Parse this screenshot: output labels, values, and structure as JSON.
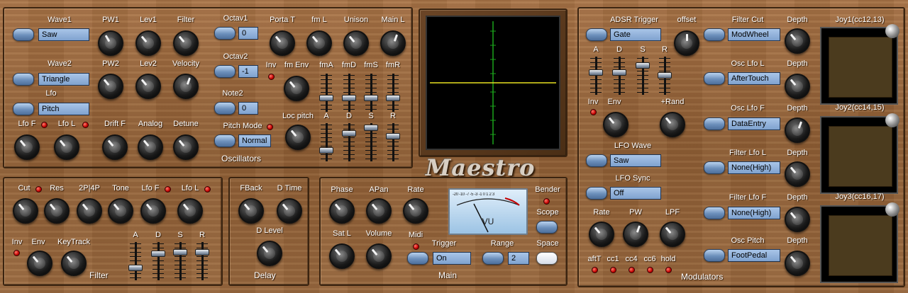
{
  "osc": {
    "wave1": {
      "label": "Wave1",
      "value": "Saw"
    },
    "wave2": {
      "label": "Wave2",
      "value": "Triangle"
    },
    "lfo": {
      "label": "Lfo",
      "value": "Pitch"
    },
    "pw1": "PW1",
    "lev1": "Lev1",
    "filter": "Filter",
    "pw2": "PW2",
    "lev2": "Lev2",
    "velocity": "Velocity",
    "lfo_f": "Lfo F",
    "lfo_l": "Lfo L",
    "drift_f": "Drift F",
    "analog": "Analog",
    "detune": "Detune",
    "octav1": {
      "label": "Octav1",
      "value": "0"
    },
    "octav2": {
      "label": "Octav2",
      "value": "-1"
    },
    "note2": {
      "label": "Note2",
      "value": "0"
    },
    "pitch_mode": {
      "label": "Pitch Mode",
      "value": "Normal"
    },
    "porta_t": "Porta T",
    "fm_l": "fm L",
    "unison": "Unison",
    "main_l": "Main L",
    "inv": "Inv",
    "fm_env": "fm Env",
    "fma": "fmA",
    "fmd": "fmD",
    "fms": "fmS",
    "fmr": "fmR",
    "loc_pitch": "Loc pitch",
    "a": "A",
    "d": "D",
    "s": "S",
    "r": "R",
    "title": "Oscillators"
  },
  "brand": "Maestro",
  "mod": {
    "adsr_trigger": {
      "label": "ADSR Trigger",
      "value": "Gate"
    },
    "offset": "offset",
    "a": "A",
    "d": "D",
    "s": "S",
    "r": "R",
    "inv": "Inv",
    "env": "Env",
    "rand": "+Rand",
    "lfo_wave": {
      "label": "LFO Wave",
      "value": "Saw"
    },
    "lfo_sync": {
      "label": "LFO Sync",
      "value": "Off"
    },
    "rate": "Rate",
    "pw": "PW",
    "lpf": "LPF",
    "aftt": "aftT",
    "cc1": "cc1",
    "cc4": "cc4",
    "cc6": "cc6",
    "hold": "hold",
    "filter_cut": {
      "label": "Filter Cut",
      "value": "ModWheel"
    },
    "osc_lfo_l": {
      "label": "Osc Lfo L",
      "value": "AfterTouch"
    },
    "osc_lfo_f": {
      "label": "Osc Lfo F",
      "value": "DataEntry"
    },
    "filter_lfo_l": {
      "label": "Filter Lfo L",
      "value": "None(High)"
    },
    "filter_lfo_f": {
      "label": "Filter Lfo F",
      "value": "None(High)"
    },
    "osc_pitch": {
      "label": "Osc Pitch",
      "value": "FootPedal"
    },
    "depth": "Depth",
    "title": "Modulators"
  },
  "joys": [
    "Joy1(cc12,13)",
    "Joy2(cc14,15)",
    "Joy3(cc16,17)"
  ],
  "filter": {
    "cut": "Cut",
    "res": "Res",
    "mode": "2P|4P",
    "tone": "Tone",
    "lfo_f": "Lfo F",
    "lfo_l": "Lfo L",
    "inv": "Inv",
    "env": "Env",
    "keytrack": "KeyTrack",
    "a": "A",
    "d": "D",
    "s": "S",
    "r": "R",
    "title": "Filter"
  },
  "delay": {
    "fback": "FBack",
    "dtime": "D Time",
    "dlevel": "D Level",
    "title": "Delay"
  },
  "main": {
    "phase": "Phase",
    "apan": "APan",
    "rate": "Rate",
    "sat_l": "Sat L",
    "volume": "Volume",
    "midi": "Midi",
    "trigger": {
      "label": "Trigger",
      "value": "On"
    },
    "range": {
      "label": "Range",
      "value": "2"
    },
    "bender": "Bender",
    "scope": "Scope",
    "space": "Space",
    "vu": "VU",
    "vu_scale": "-20 -10 -7 -5 -3 -1 0 1 2 3",
    "title": "Main"
  },
  "colors": {
    "wood": "#9a6a40",
    "field": "#8fb0d8",
    "led": "#c40000",
    "scope_trace": "#e8e020",
    "scope_axis": "#1aa31a"
  }
}
